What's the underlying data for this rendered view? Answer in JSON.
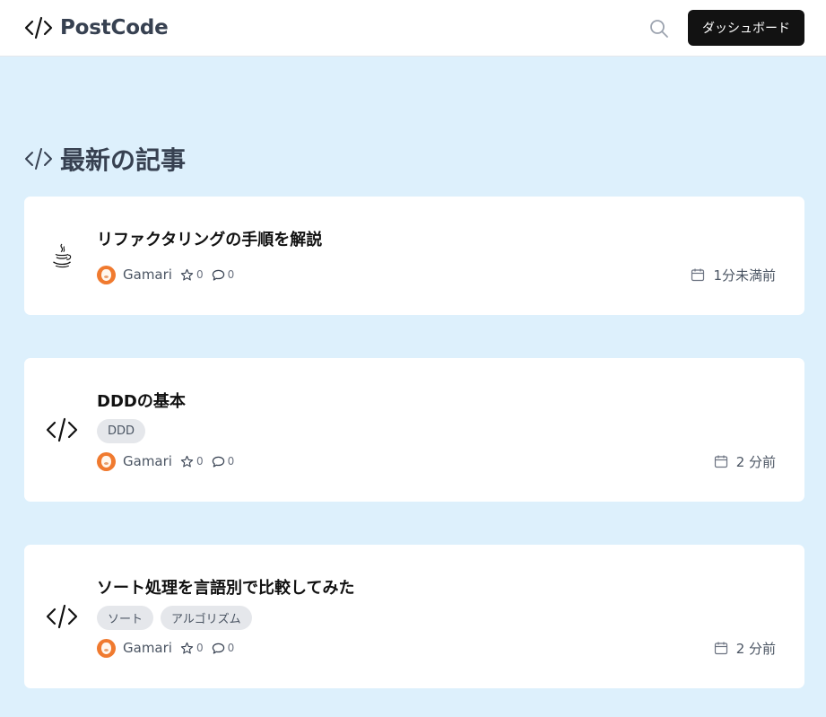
{
  "header": {
    "brand": "PostCode",
    "dashboard_label": "ダッシュボード"
  },
  "section": {
    "title": "最新の記事"
  },
  "articles": [
    {
      "title": "リファクタリングの手順を解説",
      "icon": "java-coffee-icon",
      "tags": [],
      "author": "Gamari",
      "stars": "0",
      "comments": "0",
      "date": "1分未満前"
    },
    {
      "title": "DDDの基本",
      "icon": "code-icon",
      "tags": [
        "DDD"
      ],
      "author": "Gamari",
      "stars": "0",
      "comments": "0",
      "date": "2 分前"
    },
    {
      "title": "ソート処理を言語別で比較してみた",
      "icon": "code-icon",
      "tags": [
        "ソート",
        "アルゴリズム"
      ],
      "author": "Gamari",
      "stars": "0",
      "comments": "0",
      "date": "2 分前"
    }
  ],
  "colors": {
    "page_background": "#ddf0fc",
    "dashboard_button": "#121212",
    "tag_background": "#e5e7eb",
    "avatar": "#f07a2f"
  }
}
